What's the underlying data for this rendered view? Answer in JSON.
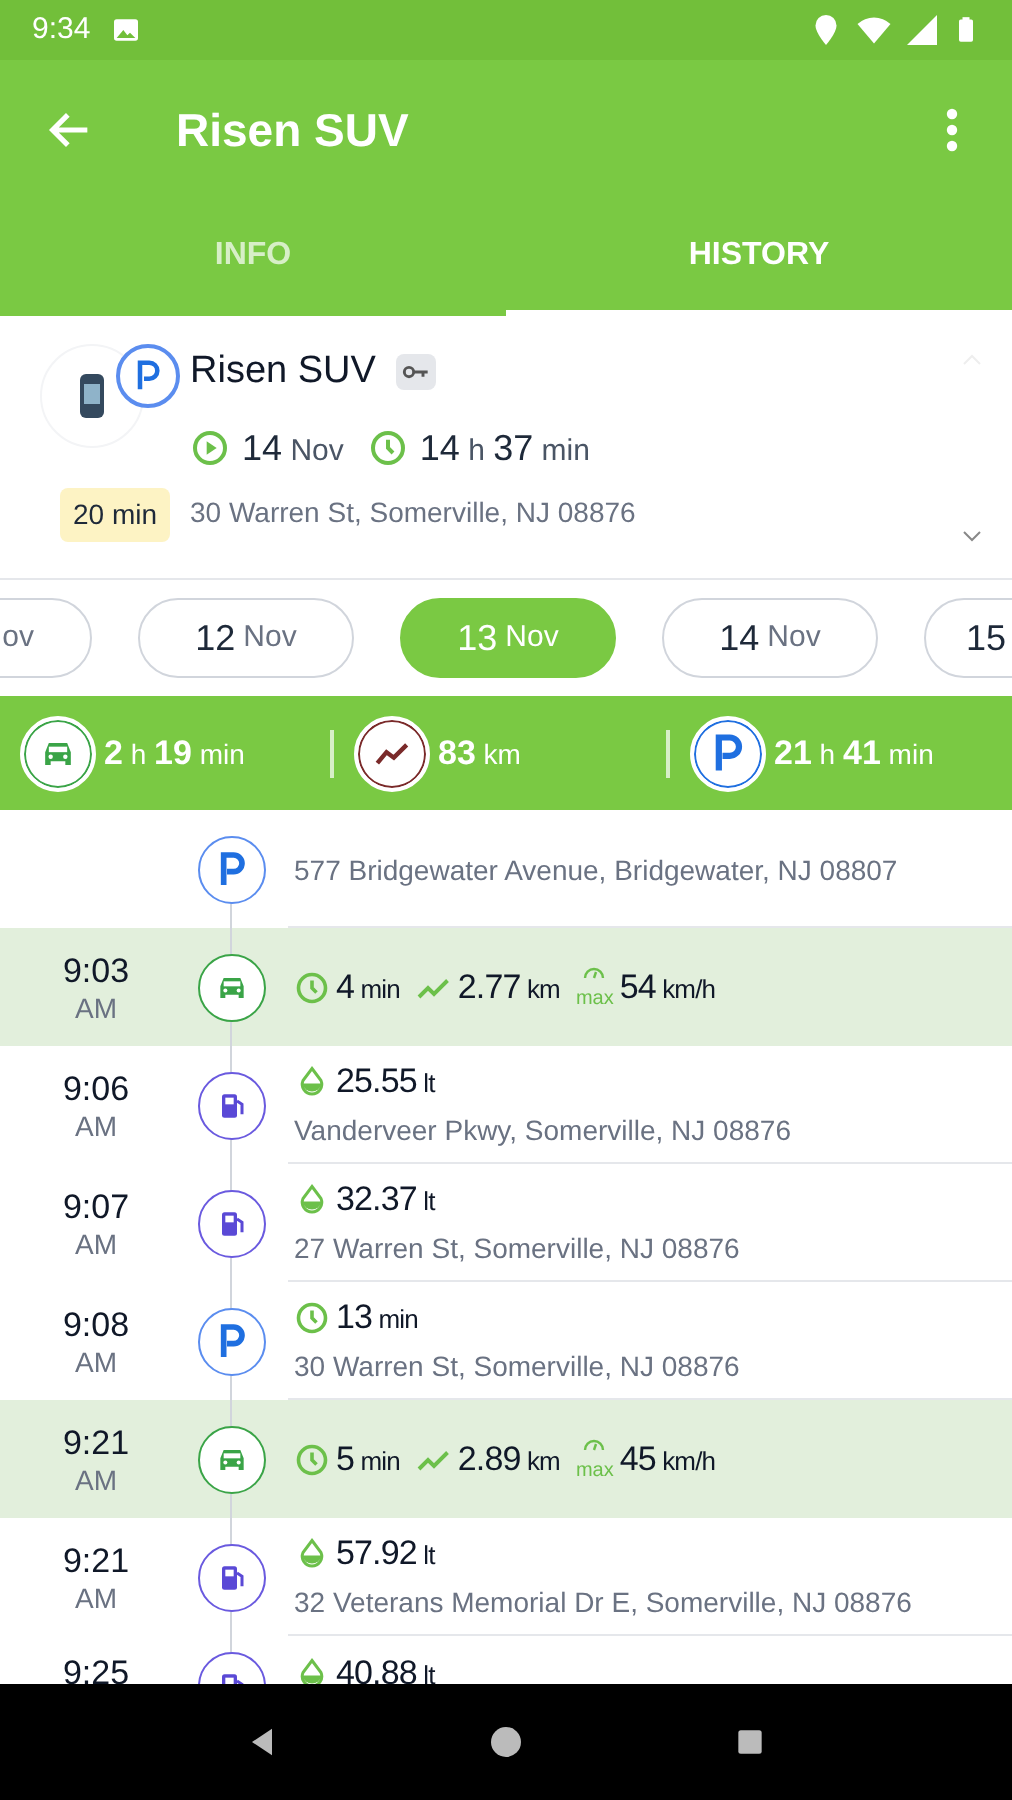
{
  "status_bar": {
    "time": "9:34"
  },
  "toolbar": {
    "title": "Risen SUV"
  },
  "tabs": [
    {
      "label": "INFO",
      "selected": false
    },
    {
      "label": "HISTORY",
      "selected": true
    }
  ],
  "summary": {
    "name": "Risen SUV",
    "badge": "20 min",
    "date": [
      [
        "14",
        "Nov"
      ]
    ],
    "duration": [
      [
        "14",
        "h"
      ],
      [
        "37",
        "min"
      ]
    ],
    "address": "30 Warren St, Somerville, NJ 08876"
  },
  "dates": [
    {
      "month": "ov",
      "selected": false
    },
    {
      "day": "12",
      "month": "Nov",
      "selected": false
    },
    {
      "day": "13",
      "month": "Nov",
      "selected": true
    },
    {
      "day": "14",
      "month": "Nov",
      "selected": false
    },
    {
      "day": "15",
      "selected": false
    }
  ],
  "totals": [
    {
      "kind": "drive",
      "value": [
        [
          "2",
          "h"
        ],
        [
          "19",
          "min"
        ]
      ]
    },
    {
      "kind": "distance",
      "value": [
        [
          "83",
          "km"
        ]
      ]
    },
    {
      "kind": "parking",
      "value": [
        [
          "21",
          "h"
        ],
        [
          "41",
          "min"
        ]
      ]
    }
  ],
  "timeline": [
    {
      "kind": "parking",
      "address": "577 Bridgewater Avenue, Bridgewater, NJ 08807"
    },
    {
      "kind": "drive",
      "time": "9:03",
      "ampm": "AM",
      "duration": [
        [
          "4",
          "min"
        ]
      ],
      "distance": [
        [
          "2.77",
          "km"
        ]
      ],
      "max_label": "max",
      "speed": [
        [
          "54",
          "km/h"
        ]
      ]
    },
    {
      "kind": "fuel",
      "time": "9:06",
      "ampm": "AM",
      "amount": [
        [
          "25.55",
          "lt"
        ]
      ],
      "address": "Vanderveer Pkwy, Somerville, NJ 08876"
    },
    {
      "kind": "fuel",
      "time": "9:07",
      "ampm": "AM",
      "amount": [
        [
          "32.37",
          "lt"
        ]
      ],
      "address": "27 Warren St, Somerville, NJ 08876"
    },
    {
      "kind": "parking",
      "time": "9:08",
      "ampm": "AM",
      "duration": [
        [
          "13",
          "min"
        ]
      ],
      "address": "30 Warren St, Somerville, NJ 08876"
    },
    {
      "kind": "drive",
      "time": "9:21",
      "ampm": "AM",
      "duration": [
        [
          "5",
          "min"
        ]
      ],
      "distance": [
        [
          "2.89",
          "km"
        ]
      ],
      "max_label": "max",
      "speed": [
        [
          "45",
          "km/h"
        ]
      ]
    },
    {
      "kind": "fuel",
      "time": "9:21",
      "ampm": "AM",
      "amount": [
        [
          "57.92",
          "lt"
        ]
      ],
      "address": "32 Veterans Memorial Dr E, Somerville, NJ 08876"
    },
    {
      "kind": "fuel",
      "time": "9:25",
      "amount": [
        [
          "40.88",
          "lt"
        ]
      ]
    }
  ]
}
